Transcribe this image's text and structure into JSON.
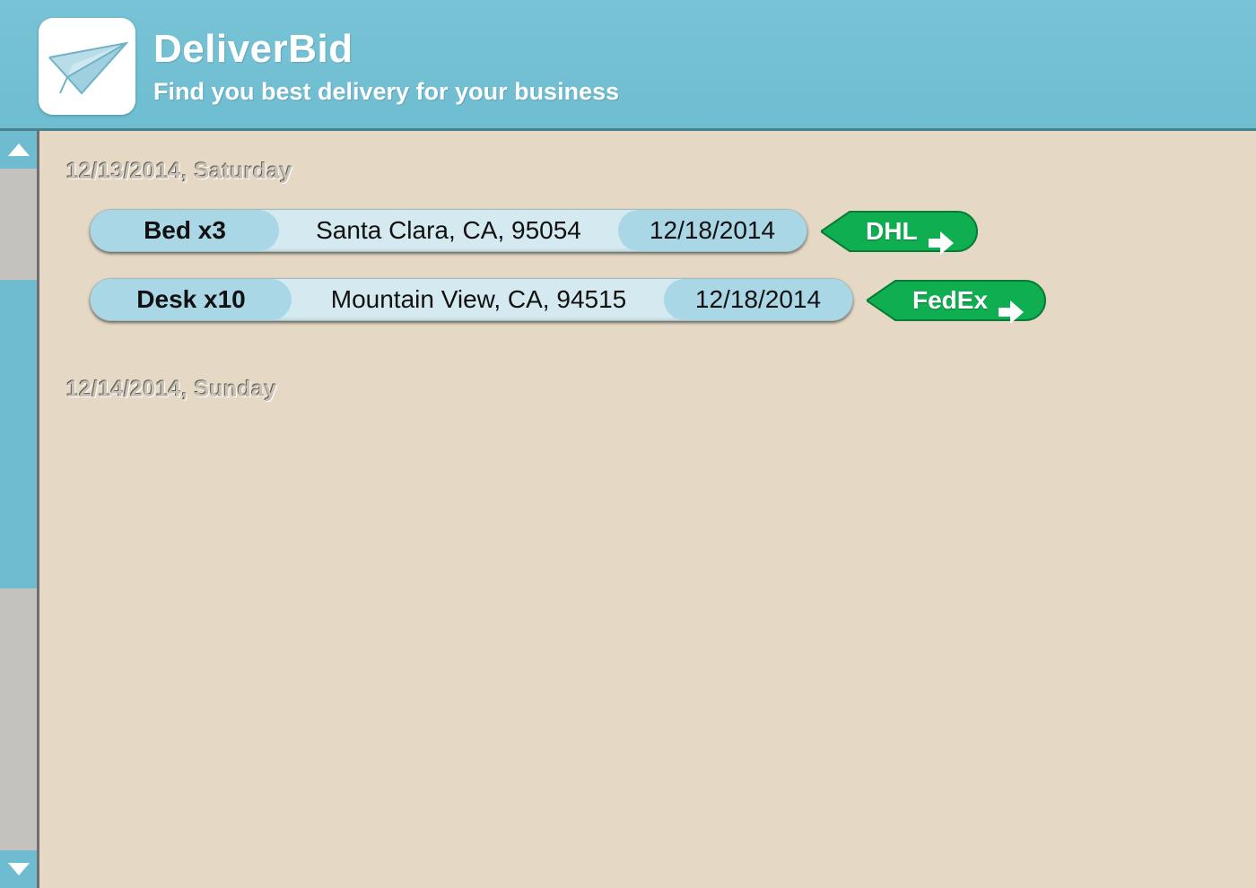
{
  "app": {
    "title": "DeliverBid",
    "subtitle": "Find you best delivery for your business",
    "logo_icon": "paper-plane-icon"
  },
  "colors": {
    "header": "#72bfd3",
    "background": "#e5d9c5",
    "pill": "#a9d7e5",
    "carrier_button": "#10b153"
  },
  "days": [
    {
      "heading": "12/13/2014, Saturday",
      "orders": [
        {
          "item": "Bed x3",
          "address": "Santa Clara, CA, 95054",
          "date": "12/18/2014",
          "carrier": "DHL"
        },
        {
          "item": "Desk x10",
          "address": "Mountain View, CA, 94515",
          "date": "12/18/2014",
          "carrier": "FedEx"
        }
      ]
    },
    {
      "heading": "12/14/2014, Sunday",
      "orders": []
    }
  ],
  "scrollbar": {
    "up_icon": "triangle-up-icon",
    "down_icon": "triangle-down-icon"
  }
}
